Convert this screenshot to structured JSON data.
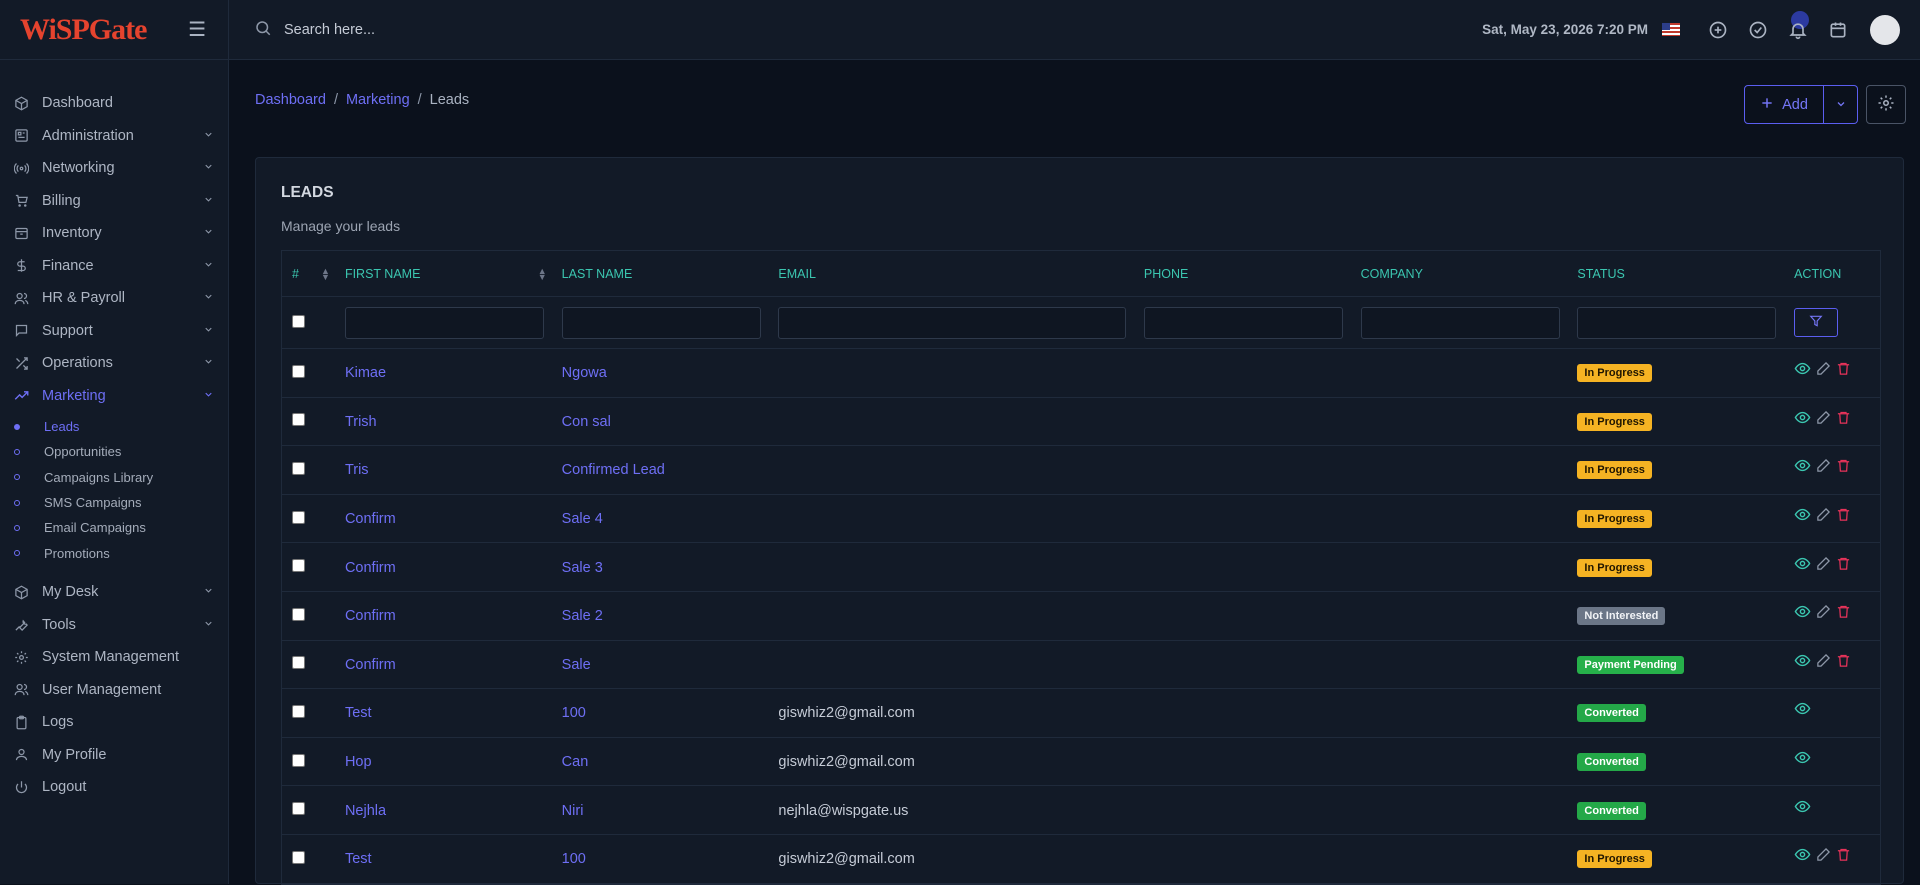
{
  "app": {
    "logo": "WiSPGate"
  },
  "topbar": {
    "search_placeholder": "Search here...",
    "datetime": "Sat, May 23, 2026 7:20 PM"
  },
  "sidebar": {
    "items": [
      {
        "label": "Dashboard",
        "icon": "box-icon",
        "chevron": false
      },
      {
        "label": "Administration",
        "icon": "admin-icon",
        "chevron": true
      },
      {
        "label": "Networking",
        "icon": "broadcast-icon",
        "chevron": true
      },
      {
        "label": "Billing",
        "icon": "cart-icon",
        "chevron": true
      },
      {
        "label": "Inventory",
        "icon": "archive-icon",
        "chevron": true
      },
      {
        "label": "Finance",
        "icon": "dollar-icon",
        "chevron": true
      },
      {
        "label": "HR & Payroll",
        "icon": "users-icon",
        "chevron": true
      },
      {
        "label": "Support",
        "icon": "chat-icon",
        "chevron": true
      },
      {
        "label": "Operations",
        "icon": "shuffle-icon",
        "chevron": true
      },
      {
        "label": "Marketing",
        "icon": "trending-icon",
        "chevron": true,
        "active": true
      }
    ],
    "sub_items": [
      {
        "label": "Leads",
        "active": true
      },
      {
        "label": "Opportunities"
      },
      {
        "label": "Campaigns Library"
      },
      {
        "label": "SMS Campaigns"
      },
      {
        "label": "Email Campaigns"
      },
      {
        "label": "Promotions"
      }
    ],
    "items_after": [
      {
        "label": "My Desk",
        "icon": "box-icon",
        "chevron": true
      },
      {
        "label": "Tools",
        "icon": "wrench-icon",
        "chevron": true
      },
      {
        "label": "System Management",
        "icon": "gear-icon",
        "chevron": false
      },
      {
        "label": "User Management",
        "icon": "users-icon",
        "chevron": false
      },
      {
        "label": "Logs",
        "icon": "clipboard-icon",
        "chevron": false
      },
      {
        "label": "My Profile",
        "icon": "user-icon",
        "chevron": false
      },
      {
        "label": "Logout",
        "icon": "power-icon",
        "chevron": false
      }
    ]
  },
  "breadcrumb": {
    "items": [
      "Dashboard",
      "Marketing"
    ],
    "current": "Leads"
  },
  "actions": {
    "add_label": "Add"
  },
  "card": {
    "title": "LEADS",
    "subtitle": "Manage your leads"
  },
  "table": {
    "headers": [
      "#",
      "FIRST NAME",
      "LAST NAME",
      "EMAIL",
      "PHONE",
      "COMPANY",
      "STATUS",
      "ACTION"
    ],
    "rows": [
      {
        "first": "Kimae",
        "last": "Ngowa",
        "email": "",
        "phone": "",
        "company": "",
        "status": "In Progress",
        "status_type": "prog",
        "actions": [
          "view",
          "edit",
          "delete"
        ]
      },
      {
        "first": "Trish",
        "last": "Con sal",
        "email": "",
        "phone": "",
        "company": "",
        "status": "In Progress",
        "status_type": "prog",
        "actions": [
          "view",
          "edit",
          "delete"
        ]
      },
      {
        "first": "Tris",
        "last": "Confirmed Lead",
        "email": "",
        "phone": "",
        "company": "",
        "status": "In Progress",
        "status_type": "prog",
        "actions": [
          "view",
          "edit",
          "delete"
        ]
      },
      {
        "first": "Confirm",
        "last": "Sale 4",
        "email": "",
        "phone": "",
        "company": "",
        "status": "In Progress",
        "status_type": "prog",
        "actions": [
          "view",
          "edit",
          "delete"
        ]
      },
      {
        "first": "Confirm",
        "last": "Sale 3",
        "email": "",
        "phone": "",
        "company": "",
        "status": "In Progress",
        "status_type": "prog",
        "actions": [
          "view",
          "edit",
          "delete"
        ]
      },
      {
        "first": "Confirm",
        "last": "Sale 2",
        "email": "",
        "phone": "",
        "company": "",
        "status": "Not Interested",
        "status_type": "not",
        "actions": [
          "view",
          "edit",
          "delete"
        ]
      },
      {
        "first": "Confirm",
        "last": "Sale",
        "email": "",
        "phone": "",
        "company": "",
        "status": "Payment Pending",
        "status_type": "pay",
        "actions": [
          "view",
          "edit",
          "delete"
        ]
      },
      {
        "first": "Test",
        "last": "100",
        "email": "giswhiz2@gmail.com",
        "phone": "",
        "company": "",
        "status": "Converted",
        "status_type": "conv",
        "actions": [
          "view"
        ]
      },
      {
        "first": "Hop",
        "last": "Can",
        "email": "giswhiz2@gmail.com",
        "phone": "",
        "company": "",
        "status": "Converted",
        "status_type": "conv",
        "actions": [
          "view"
        ]
      },
      {
        "first": "Nejhla",
        "last": "Niri",
        "email": "nejhla@wispgate.us",
        "phone": "",
        "company": "",
        "status": "Converted",
        "status_type": "conv",
        "actions": [
          "view"
        ]
      },
      {
        "first": "Test",
        "last": "100",
        "email": "giswhiz2@gmail.com",
        "phone": "",
        "company": "",
        "status": "In Progress",
        "status_type": "prog",
        "actions": [
          "view",
          "edit",
          "delete"
        ]
      }
    ]
  }
}
